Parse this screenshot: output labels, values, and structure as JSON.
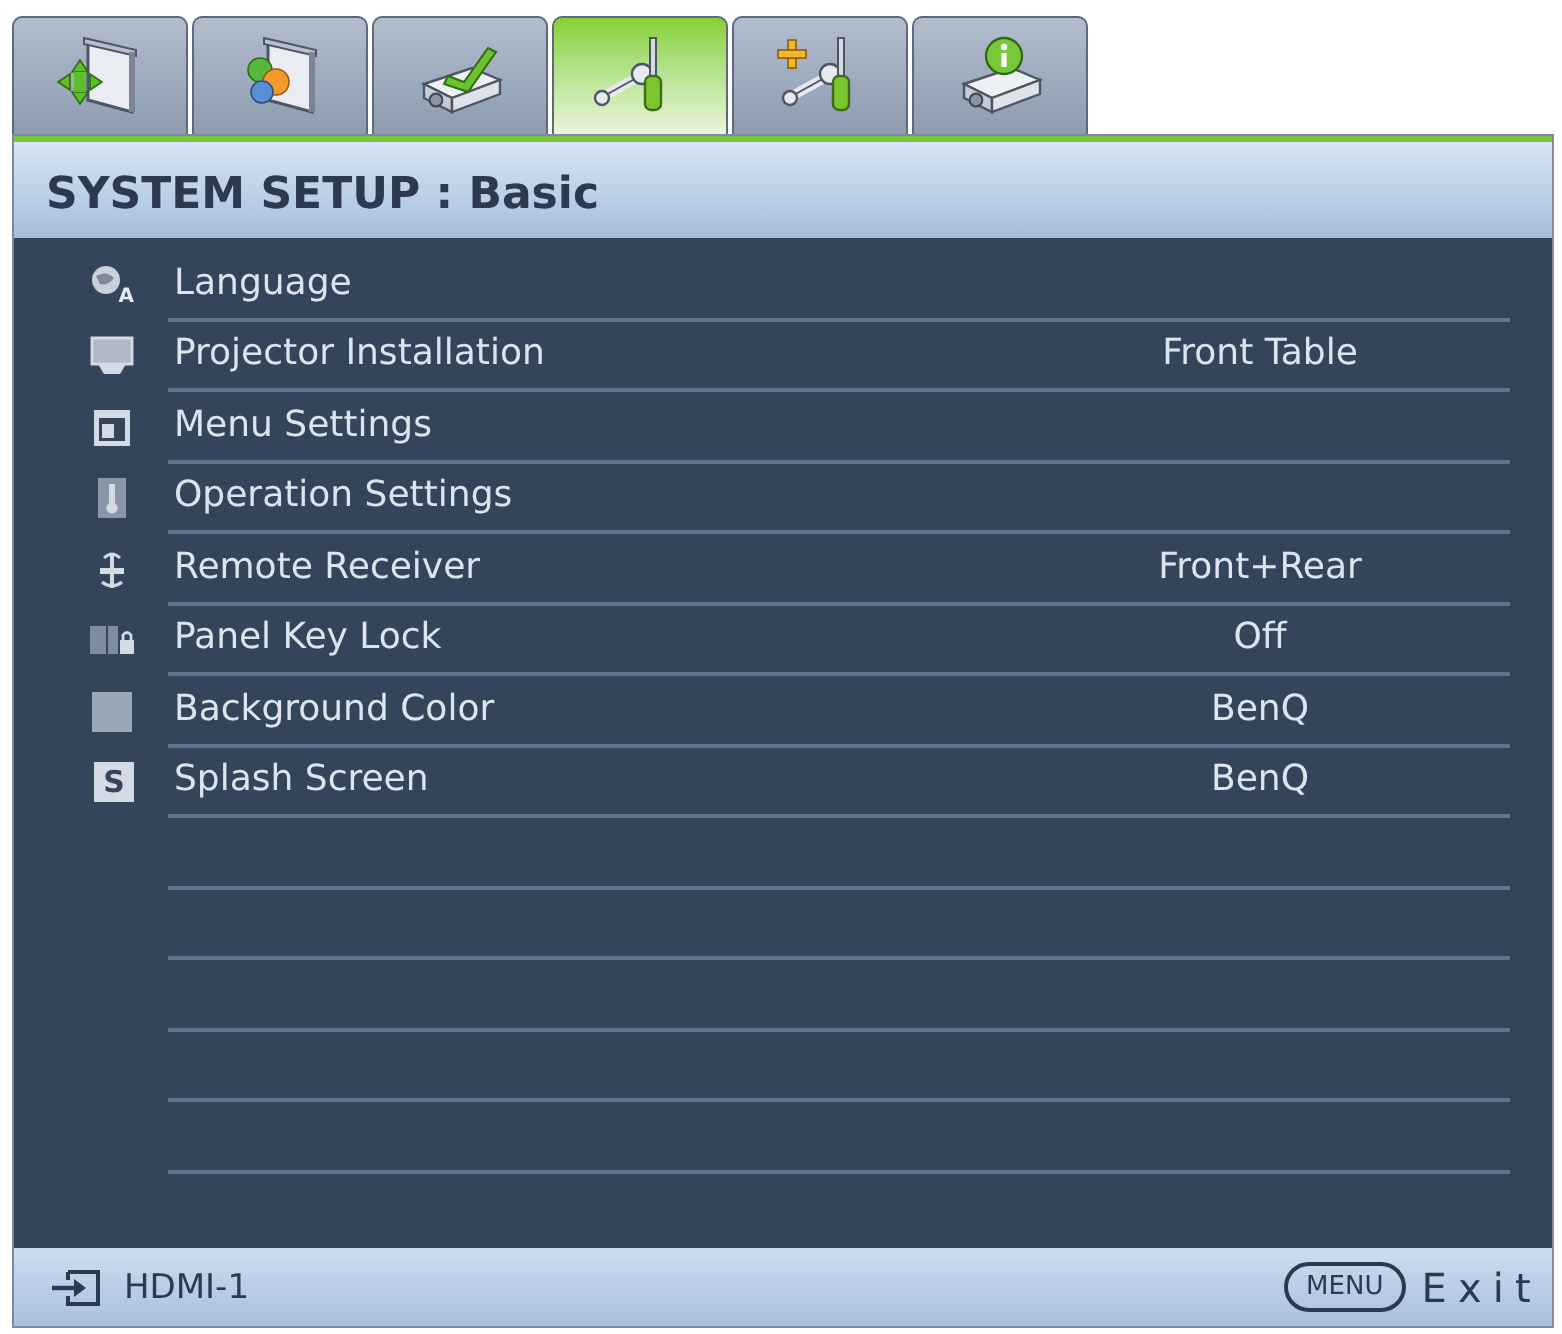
{
  "tabs": [
    {
      "selected": false
    },
    {
      "selected": false
    },
    {
      "selected": false
    },
    {
      "selected": true
    },
    {
      "selected": false
    },
    {
      "selected": false
    }
  ],
  "header": {
    "title": "SYSTEM SETUP : Basic"
  },
  "menu": {
    "items": [
      {
        "label": "Language",
        "icon_glyph": "A",
        "selected": false
      },
      {
        "label": "Projector Installation",
        "value": "Front Table",
        "selected": false
      },
      {
        "label": "Menu Settings",
        "selected": false
      },
      {
        "label": "Operation Settings",
        "selected": false
      },
      {
        "label": "Remote Receiver",
        "value": "Front+Rear",
        "selected": false
      },
      {
        "label": "Panel Key Lock",
        "value": "Off",
        "selected": false
      },
      {
        "label": "Background Color",
        "value": "BenQ",
        "selected": false
      },
      {
        "label": "Splash Screen",
        "value": "BenQ",
        "icon_glyph": "S",
        "selected": false
      }
    ]
  },
  "footer": {
    "source": "HDMI-1",
    "key": "MENU",
    "action": "Exit"
  }
}
